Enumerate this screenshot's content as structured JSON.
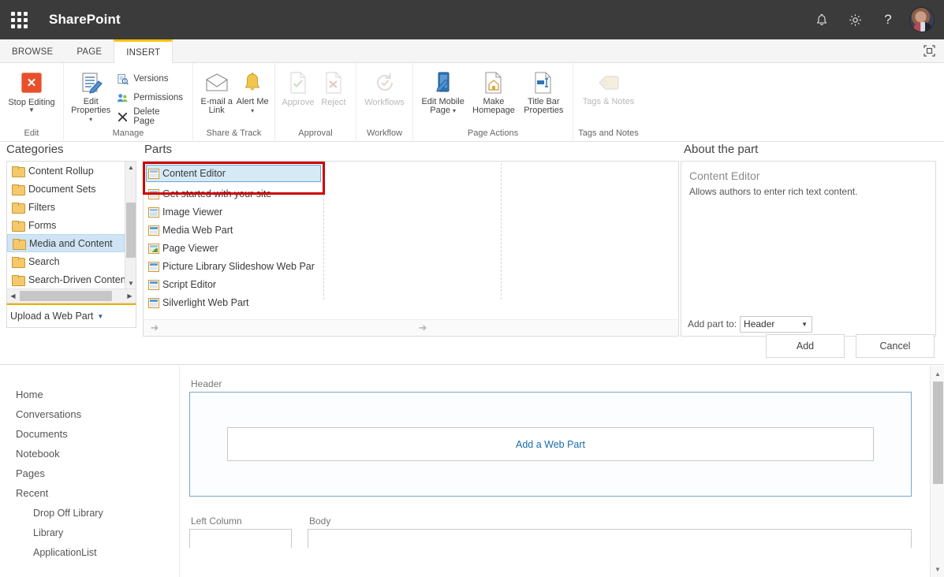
{
  "suite": {
    "waffle_icon": "app-launcher-icon",
    "title": "SharePoint",
    "icons": [
      {
        "name": "notifications-icon",
        "glyph": "bell"
      },
      {
        "name": "settings-gear-icon",
        "glyph": "gear"
      },
      {
        "name": "help-icon",
        "glyph": "?"
      }
    ],
    "avatar": "user-avatar"
  },
  "ribbon": {
    "tabs": [
      {
        "label": "BROWSE",
        "active": false
      },
      {
        "label": "PAGE",
        "active": false
      },
      {
        "label": "INSERT",
        "active": true
      }
    ],
    "focus_on_content": "focus-on-content-icon",
    "groups": [
      {
        "label": "Edit",
        "buttons": [
          {
            "label": "Stop Editing",
            "icon": "stop-editing-icon",
            "has_caret": true,
            "disabled": false
          }
        ]
      },
      {
        "label": "Manage",
        "buttons": [
          {
            "label": "Edit Properties",
            "icon": "edit-properties-icon",
            "has_caret": true,
            "disabled": false
          }
        ],
        "small_buttons": [
          {
            "label": "Versions",
            "icon": "versions-icon"
          },
          {
            "label": "Permissions",
            "icon": "permissions-icon"
          },
          {
            "label": "Delete Page",
            "icon": "delete-page-icon"
          }
        ]
      },
      {
        "label": "Share & Track",
        "buttons": [
          {
            "label": "E-mail a Link",
            "icon": "email-link-icon",
            "has_caret": false,
            "disabled": false
          },
          {
            "label": "Alert Me",
            "icon": "alert-me-icon",
            "has_caret": true,
            "disabled": false
          }
        ]
      },
      {
        "label": "Approval",
        "buttons": [
          {
            "label": "Approve",
            "icon": "approve-icon",
            "has_caret": false,
            "disabled": true
          },
          {
            "label": "Reject",
            "icon": "reject-icon",
            "has_caret": false,
            "disabled": true
          }
        ]
      },
      {
        "label": "Workflow",
        "buttons": [
          {
            "label": "Workflows",
            "icon": "workflows-icon",
            "has_caret": false,
            "disabled": true
          }
        ]
      },
      {
        "label": "Page Actions",
        "buttons": [
          {
            "label": "Edit Mobile Page",
            "icon": "edit-mobile-page-icon",
            "has_caret": true,
            "disabled": false
          },
          {
            "label": "Make Homepage",
            "icon": "make-homepage-icon",
            "has_caret": false,
            "disabled": false
          },
          {
            "label": "Title Bar Properties",
            "icon": "title-bar-properties-icon",
            "has_caret": false,
            "disabled": false
          }
        ]
      },
      {
        "label": "Tags and Notes",
        "buttons": [
          {
            "label": "Tags & Notes",
            "icon": "tags-notes-icon",
            "has_caret": false,
            "disabled": true
          }
        ]
      }
    ]
  },
  "picker": {
    "categories_heading": "Categories",
    "categories": [
      {
        "label": "Content Rollup",
        "selected": false
      },
      {
        "label": "Document Sets",
        "selected": false
      },
      {
        "label": "Filters",
        "selected": false
      },
      {
        "label": "Forms",
        "selected": false
      },
      {
        "label": "Media and Content",
        "selected": true
      },
      {
        "label": "Search",
        "selected": false
      },
      {
        "label": "Search-Driven Content",
        "selected": false
      }
    ],
    "upload_label": "Upload a Web Part",
    "parts_heading": "Parts",
    "parts": [
      {
        "label": "Content Editor",
        "selected": true,
        "icon": "web-part-icon"
      },
      {
        "label": "Get started with your site",
        "selected": false,
        "icon": "web-part-icon"
      },
      {
        "label": "Image Viewer",
        "selected": false,
        "icon": "image-viewer-icon"
      },
      {
        "label": "Media Web Part",
        "selected": false,
        "icon": "media-web-part-icon"
      },
      {
        "label": "Page Viewer",
        "selected": false,
        "icon": "page-viewer-icon"
      },
      {
        "label": "Picture Library Slideshow Web Par",
        "selected": false,
        "icon": "picture-library-icon"
      },
      {
        "label": "Script Editor",
        "selected": false,
        "icon": "script-editor-icon"
      },
      {
        "label": "Silverlight Web Part",
        "selected": false,
        "icon": "silverlight-icon"
      }
    ],
    "about_heading": "About the part",
    "about_title": "Content Editor",
    "about_description": "Allows authors to enter rich text content.",
    "add_part_to_label": "Add part to:",
    "add_part_to_value": "Header",
    "add_button": "Add",
    "cancel_button": "Cancel"
  },
  "leftnav": {
    "items": [
      {
        "label": "Home",
        "sub": false
      },
      {
        "label": "Conversations",
        "sub": false
      },
      {
        "label": "Documents",
        "sub": false
      },
      {
        "label": "Notebook",
        "sub": false
      },
      {
        "label": "Pages",
        "sub": false
      },
      {
        "label": "Recent",
        "sub": false
      },
      {
        "label": "Drop Off Library",
        "sub": true
      },
      {
        "label": "Library",
        "sub": true
      },
      {
        "label": "ApplicationList",
        "sub": true
      }
    ]
  },
  "canvas": {
    "header_zone_label": "Header",
    "add_web_part": "Add a Web Part",
    "left_column_label": "Left Column",
    "body_label": "Body"
  },
  "colors": {
    "suite_bar": "#3b3b3b",
    "accent_tab": "#ffc20e",
    "selection_blue": "#d5e9f7",
    "link_blue": "#1a6ba8",
    "annotation_red": "#cc0000",
    "stop_editing_orange": "#e8502b"
  }
}
